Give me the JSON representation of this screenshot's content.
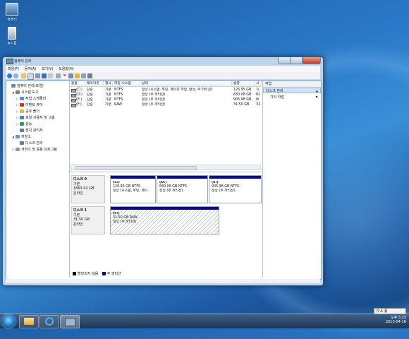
{
  "desktop": {
    "icons": [
      {
        "label": "컴퓨터",
        "icon": "computer-icon"
      },
      {
        "label": "휴지통",
        "icon": "recycle-bin-icon"
      }
    ]
  },
  "window": {
    "title": "컴퓨터 관리",
    "menu": [
      "파일(F)",
      "동작(A)",
      "보기(V)",
      "도움말(H)"
    ]
  },
  "tree": {
    "items": [
      {
        "label": "컴퓨터 관리(로컬)",
        "level": 0,
        "expander": ""
      },
      {
        "label": "시스템 도구",
        "level": 1,
        "expander": "◢"
      },
      {
        "label": "작업 스케줄러",
        "level": 2,
        "expander": "▷"
      },
      {
        "label": "이벤트 뷰어",
        "level": 2,
        "expander": "▷"
      },
      {
        "label": "공유 폴더",
        "level": 2,
        "expander": "▷"
      },
      {
        "label": "로컬 사용자 및 그룹",
        "level": 2,
        "expander": "▷"
      },
      {
        "label": "성능",
        "level": 2,
        "expander": "▷"
      },
      {
        "label": "장치 관리자",
        "level": 2,
        "expander": ""
      },
      {
        "label": "저장소",
        "level": 1,
        "expander": "◢"
      },
      {
        "label": "디스크 관리",
        "level": 2,
        "expander": ""
      },
      {
        "label": "서비스 및 응용 프로그램",
        "level": 1,
        "expander": "▷"
      }
    ]
  },
  "volumes": {
    "columns": [
      "볼륨",
      "레이아웃",
      "형식",
      "파일 시스템",
      "상태",
      "용량",
      "사"
    ],
    "rows": [
      [
        "(C:)",
        "단순",
        "기본",
        "NTFS",
        "정상 (시스템, 부팅, 페이지 파일, 활성, 주 파티션)",
        "126.95 GB",
        "1("
      ],
      [
        "(D:)",
        "단순",
        "기본",
        "NTFS",
        "정상 (주 파티션)",
        "830.08 GB",
        "82"
      ],
      [
        "(E:)",
        "단순",
        "기본",
        "NTFS",
        "정상 (주 파티션)",
        "905.98 GB",
        "8("
      ],
      [
        "(F:)",
        "단순",
        "기본",
        "RAW",
        "정상 (주 파티션)",
        "31.50 GB",
        "31"
      ]
    ]
  },
  "disks": [
    {
      "name": "디스크 0",
      "type": "기본",
      "size": "1863.02 GB",
      "status": "온라인",
      "partitions": [
        {
          "letter": "(C:)",
          "info": "126.95 GB NTFS",
          "state": "정상 (시스템, 부팅, 페이"
        },
        {
          "letter": "(D:)",
          "info": "830.08 GB NTFS",
          "state": "정상 (주 파티션)"
        },
        {
          "letter": "(E:)",
          "info": "905.98 GB NTFS",
          "state": "정상 (주 파티션)"
        }
      ]
    },
    {
      "name": "디스크 1",
      "type": "기본",
      "size": "31.50 GB",
      "status": "온라인",
      "partitions": [
        {
          "letter": "(F:)",
          "info": "31.50 GB RAW",
          "state": "정상 (주 파티션)"
        }
      ]
    }
  ],
  "legend": [
    {
      "label": "할당되지 않음",
      "color": "#000000"
    },
    {
      "label": "주 파티션",
      "color": "#0c0d7a"
    }
  ],
  "actions": {
    "header": "작업",
    "selected": "디스크 관리",
    "item": "기타 작업"
  },
  "tray": {
    "time": "오후 3:23",
    "date": "2013-04-16",
    "lang": "가 A 漢"
  }
}
